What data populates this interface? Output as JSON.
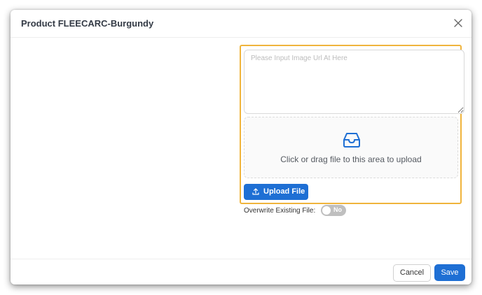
{
  "modal": {
    "title": "Product FLEECARC-Burgundy"
  },
  "image_upload": {
    "url_placeholder": "Please Input Image Url At Here",
    "url_value": "",
    "dropzone_text": "Click or drag file to this area to upload",
    "dropzone_icon": "inbox-icon",
    "upload_button_label": "Upload File",
    "upload_button_icon": "upload-icon"
  },
  "overwrite": {
    "label": "Overwrite Existing File:",
    "toggle_text": "No",
    "enabled": false
  },
  "footer": {
    "cancel_label": "Cancel",
    "save_label": "Save"
  },
  "colors": {
    "primary": "#1e6fd4",
    "highlight_border": "#f0b43c",
    "toggle_off": "#bfbfbf"
  }
}
